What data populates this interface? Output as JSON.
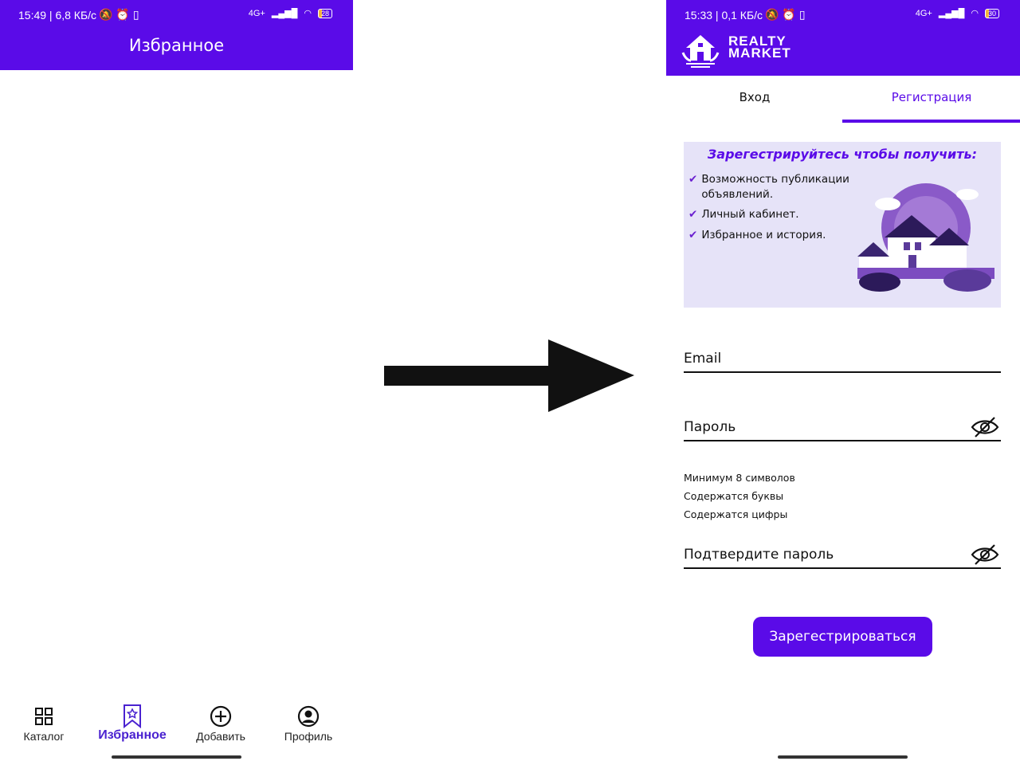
{
  "left": {
    "status": {
      "time": "15:49 | 6,8 КБ/с",
      "network": "4G+",
      "battery": "28"
    },
    "header": {
      "title": "Избранное"
    },
    "nav": [
      {
        "label": "Каталог",
        "icon": "grid-icon"
      },
      {
        "label": "Избранное",
        "icon": "bookmark-star-icon",
        "active": true
      },
      {
        "label": "Добавить",
        "icon": "plus-circle-icon"
      },
      {
        "label": "Профиль",
        "icon": "profile-icon"
      }
    ]
  },
  "right": {
    "status": {
      "time": "15:33 | 0,1 КБ/с",
      "network": "4G+",
      "battery": "30"
    },
    "logo": {
      "line1": "REALTY",
      "line2": "MARKET"
    },
    "tabs": [
      {
        "label": "Вход"
      },
      {
        "label": "Регистрация",
        "active": true
      }
    ],
    "banner": {
      "title": "Зарегестрируйтесь чтобы получить:",
      "items": [
        "Возможность публикации объявлений.",
        "Личный кабинет.",
        "Избранное и история."
      ]
    },
    "form": {
      "email_label": "Email",
      "password_label": "Пароль",
      "hints": [
        "Минимум 8 символов",
        "Содержатся буквы",
        "Содержатся цифры"
      ],
      "confirm_label": "Подтвердите пароль",
      "submit": "Зарегестрироваться"
    }
  },
  "colors": {
    "accent": "#5a0be8",
    "banner_bg": "#e6e3f8"
  }
}
